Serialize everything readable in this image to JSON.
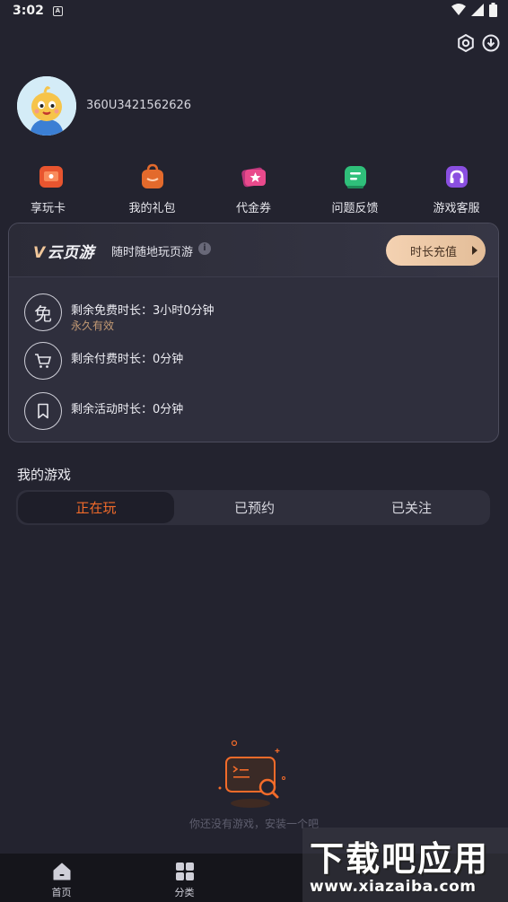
{
  "status_bar": {
    "time": "3:02"
  },
  "profile": {
    "username": "360U3421562626"
  },
  "quick_menu": [
    {
      "label": "享玩卡",
      "icon": "card-icon",
      "color": "#e8552f"
    },
    {
      "label": "我的礼包",
      "icon": "gift-bag-icon",
      "color": "#e36a2c"
    },
    {
      "label": "代金券",
      "icon": "voucher-icon",
      "color": "#e94a8c"
    },
    {
      "label": "问题反馈",
      "icon": "feedback-icon",
      "color": "#2fbf7a"
    },
    {
      "label": "游戏客服",
      "icon": "headset-icon",
      "color": "#8a4fe0"
    }
  ],
  "cloud_game": {
    "logo_v": "V",
    "logo_text": "云页游",
    "slogan": "随时随地玩页游",
    "recharge_label": "时长充值",
    "rows": [
      {
        "label": "剩余免费时长：3小时0分钟",
        "sub": "永久有效",
        "icon": "free-icon",
        "glyph": "免"
      },
      {
        "label": "剩余付费时长：0分钟",
        "icon": "cart-icon"
      },
      {
        "label": "剩余活动时长：0分钟",
        "icon": "bookmark-icon"
      }
    ]
  },
  "my_games": {
    "title": "我的游戏",
    "tabs": [
      "正在玩",
      "已预约",
      "已关注"
    ],
    "active_tab": 0,
    "empty_text": "你还没有游戏，安装一个吧"
  },
  "bottom_nav": [
    {
      "label": "首页",
      "icon": "home-icon"
    },
    {
      "label": "分类",
      "icon": "grid-icon"
    }
  ],
  "watermark": {
    "title": "下载吧应用",
    "url": "www.xiazaiba.com"
  },
  "colors": {
    "accent": "#f26b2a",
    "background": "#23232f",
    "gold": "#f1c79a"
  }
}
